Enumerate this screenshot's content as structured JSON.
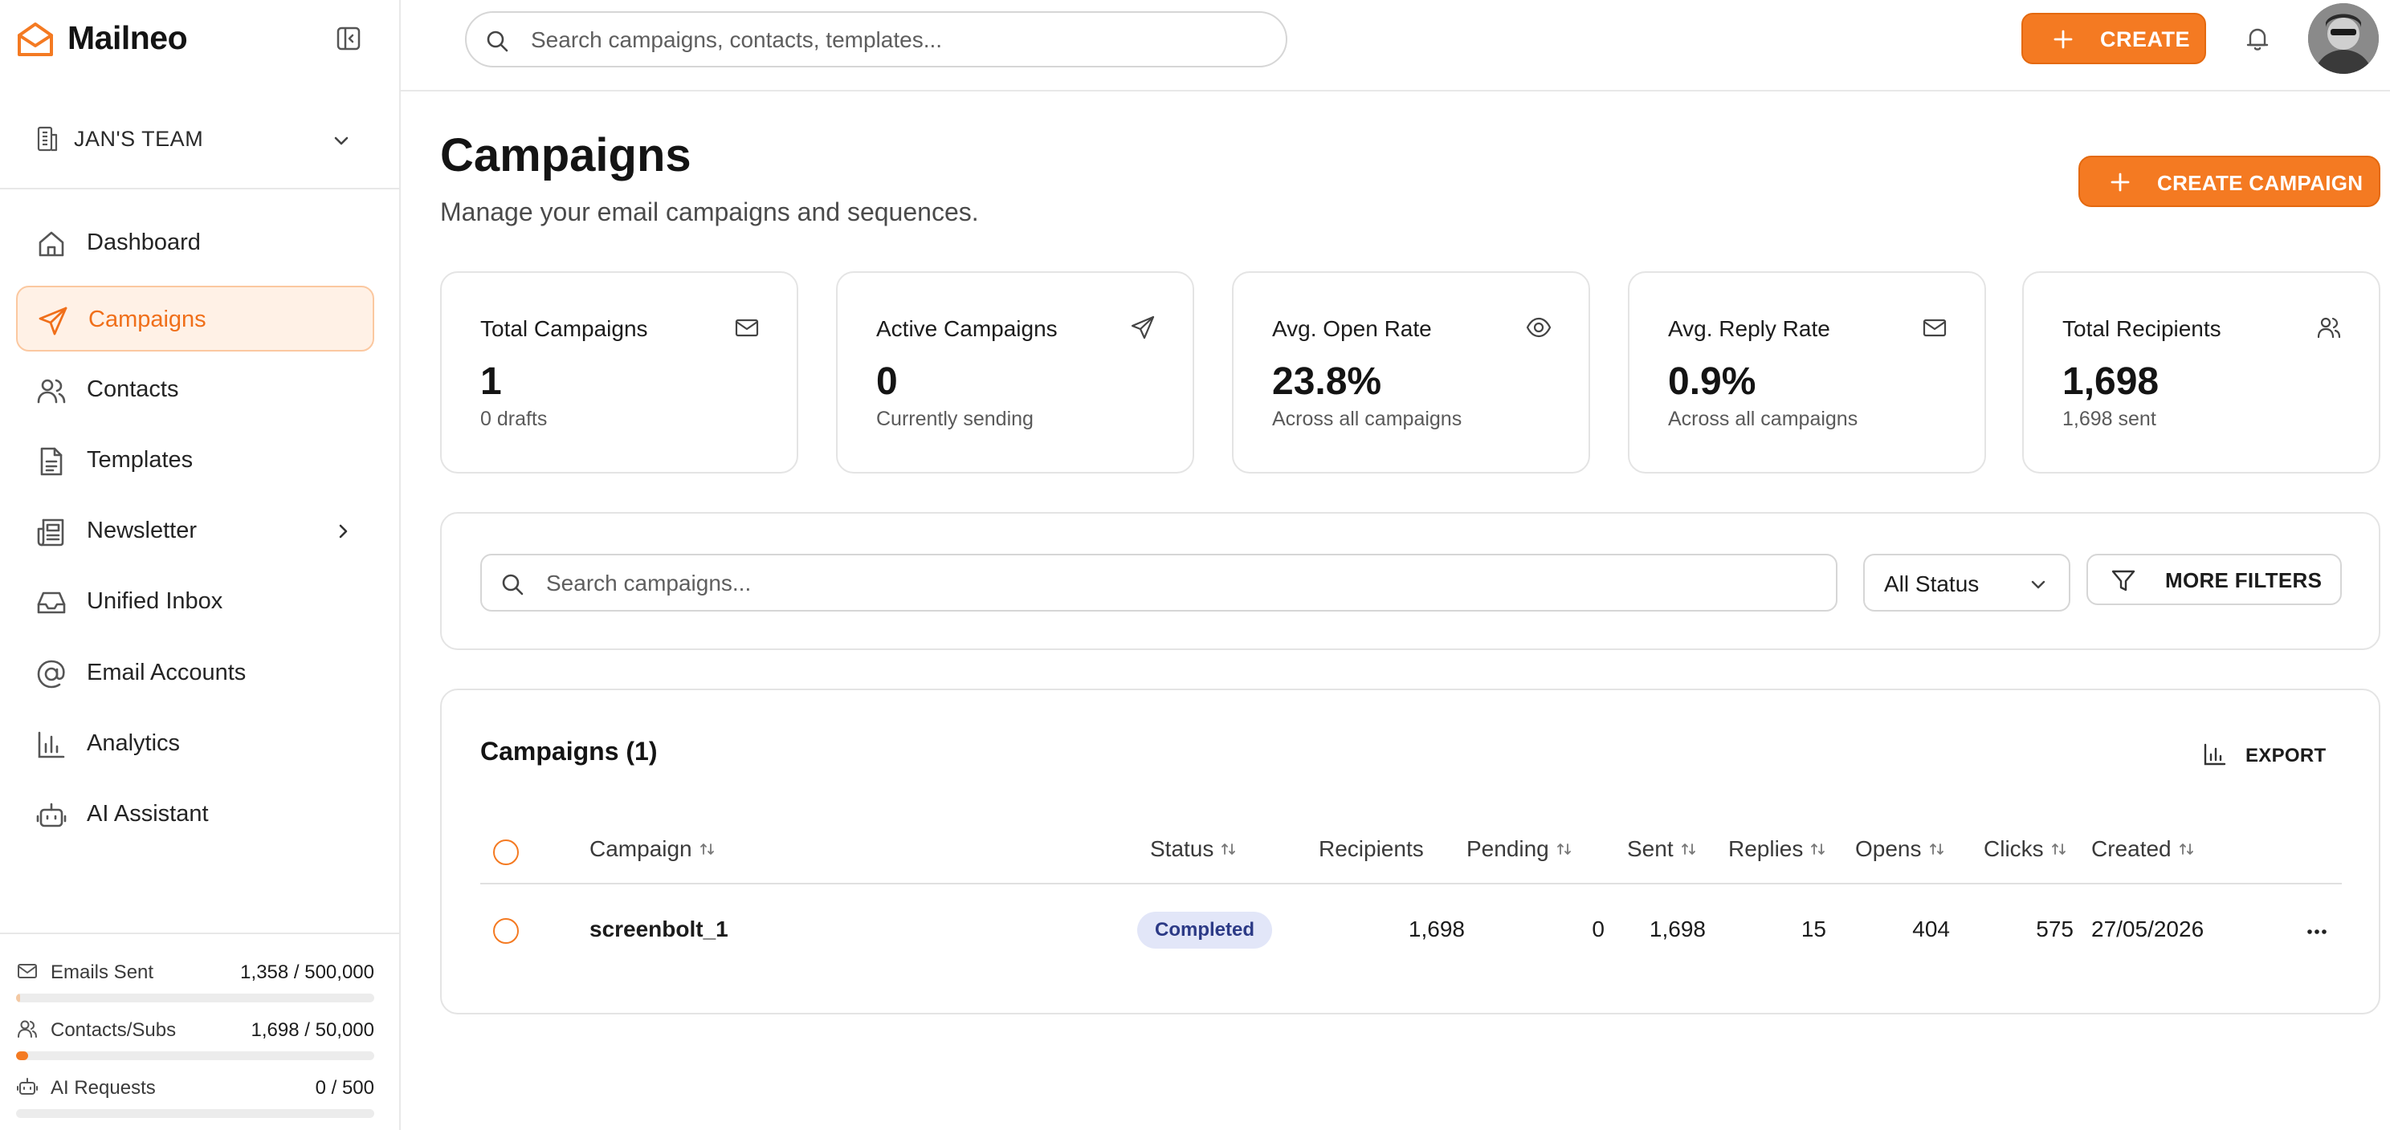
{
  "app": {
    "name": "Mailneo"
  },
  "team": {
    "name": "JAN'S TEAM"
  },
  "nav": [
    {
      "label": "Dashboard",
      "icon": "home-icon"
    },
    {
      "label": "Campaigns",
      "icon": "send-icon",
      "active": true
    },
    {
      "label": "Contacts",
      "icon": "users-icon"
    },
    {
      "label": "Templates",
      "icon": "file-text-icon"
    },
    {
      "label": "Newsletter",
      "icon": "newspaper-icon",
      "has_submenu": true
    },
    {
      "label": "Unified Inbox",
      "icon": "inbox-icon"
    },
    {
      "label": "Email Accounts",
      "icon": "at-sign-icon"
    },
    {
      "label": "Analytics",
      "icon": "bar-chart-icon"
    },
    {
      "label": "AI Assistant",
      "icon": "bot-icon"
    }
  ],
  "usage": [
    {
      "label": "Emails Sent",
      "value": "1,358 / 500,000",
      "fraction": 0.0027
    },
    {
      "label": "Contacts/Subs",
      "value": "1,698 / 50,000",
      "fraction": 0.034
    },
    {
      "label": "AI Requests",
      "value": "0 / 500",
      "fraction": 0
    }
  ],
  "topbar": {
    "search_placeholder": "Search campaigns, contacts, templates...",
    "create_label": "CREATE"
  },
  "page": {
    "title": "Campaigns",
    "subtitle": "Manage your email campaigns and sequences.",
    "create_campaign_label": "CREATE CAMPAIGN"
  },
  "stats": [
    {
      "title": "Total Campaigns",
      "value": "1",
      "note": "0 drafts",
      "icon": "mail-icon"
    },
    {
      "title": "Active Campaigns",
      "value": "0",
      "note": "Currently sending",
      "icon": "send-icon"
    },
    {
      "title": "Avg. Open Rate",
      "value": "23.8%",
      "note": "Across all campaigns",
      "icon": "eye-icon"
    },
    {
      "title": "Avg. Reply Rate",
      "value": "0.9%",
      "note": "Across all campaigns",
      "icon": "mail-icon"
    },
    {
      "title": "Total Recipients",
      "value": "1,698",
      "note": "1,698 sent",
      "icon": "users-icon"
    }
  ],
  "filters": {
    "search_placeholder": "Search campaigns...",
    "status_value": "All Status",
    "more_filters_label": "MORE FILTERS"
  },
  "table": {
    "title": "Campaigns (1)",
    "export_label": "EXPORT",
    "columns": [
      "Campaign",
      "Status",
      "Recipients",
      "Pending",
      "Sent",
      "Replies",
      "Opens",
      "Clicks",
      "Created"
    ],
    "rows": [
      {
        "campaign": "screenbolt_1",
        "status": "Completed",
        "recipients": "1,698",
        "pending": "0",
        "sent": "1,698",
        "replies": "15",
        "opens": "404",
        "clicks": "575",
        "created": "27/05/2026"
      }
    ]
  },
  "colors": {
    "accent": "#f47a22",
    "active_nav_bg": "#fff1e6",
    "badge_bg": "#e2e6f8",
    "badge_text": "#2c3a86"
  }
}
